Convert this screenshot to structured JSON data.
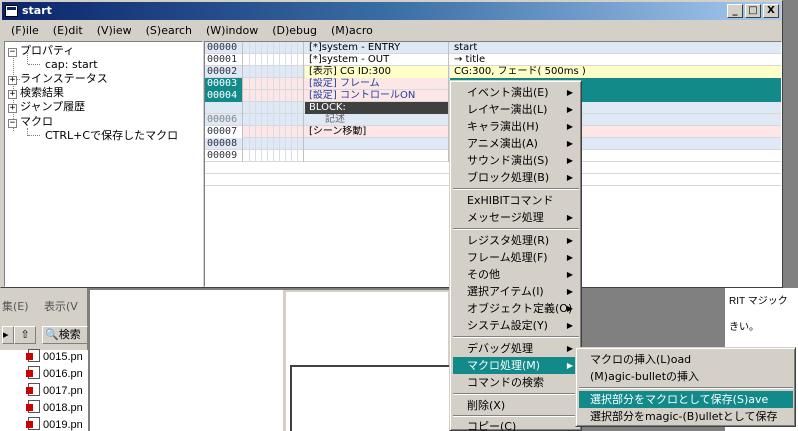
{
  "window": {
    "title": "start"
  },
  "title_controls": {
    "minimize": "_",
    "maximize": "□",
    "close": "X"
  },
  "menubar": [
    "(F)ile",
    "(E)dit",
    "(V)iew",
    "(S)earch",
    "(W)indow",
    "(D)ebug",
    "(M)acro"
  ],
  "tree": {
    "items": [
      {
        "expander": "−",
        "label": "プロパティ"
      },
      {
        "expander": "",
        "label": "cap: start"
      },
      {
        "expander": "+",
        "label": "ラインステータス"
      },
      {
        "expander": "+",
        "label": "検索結果"
      },
      {
        "expander": "+",
        "label": "ジャンプ履歴"
      },
      {
        "expander": "−",
        "label": "マクロ"
      },
      {
        "expander": "",
        "label": "CTRL+Cで保存したマクロ"
      }
    ]
  },
  "grid": {
    "rows": [
      {
        "num": "00000",
        "cmd": "[*]system -  ENTRY",
        "arg": "start"
      },
      {
        "num": "00001",
        "cmd": "[*]system -  OUT",
        "arg": "→ title"
      },
      {
        "num": "00002",
        "cmd": "[表示] CG ID:300",
        "arg": "CG:300, フェード( 500ms )"
      },
      {
        "num": "00003",
        "cmd": "[設定] フレーム",
        "arg": ""
      },
      {
        "num": "00004",
        "cmd": "[設定] コントロールON",
        "arg": ""
      },
      {
        "num": "",
        "cmd": "BLOCK:",
        "arg": ""
      },
      {
        "num": "00006",
        "cmd": "記述",
        "arg": ""
      },
      {
        "num": "00007",
        "cmd": "[シーン移動]",
        "arg": ""
      },
      {
        "num": "00008",
        "cmd": "",
        "arg": ""
      },
      {
        "num": "00009",
        "cmd": "",
        "arg": ""
      }
    ]
  },
  "context_menu": {
    "items": [
      {
        "label": "イベント演出(E)",
        "submenu": true
      },
      {
        "label": "レイヤー演出(L)",
        "submenu": true
      },
      {
        "label": "キャラ演出(H)",
        "submenu": true
      },
      {
        "label": "アニメ演出(A)",
        "submenu": true
      },
      {
        "label": "サウンド演出(S)",
        "submenu": true
      },
      {
        "label": "ブロック処理(B)",
        "submenu": true
      },
      {
        "label": "ExHIBITコマンド",
        "submenu": false
      },
      {
        "label": "メッセージ処理",
        "submenu": true
      },
      {
        "label": "レジスタ処理(R)",
        "submenu": true
      },
      {
        "label": "フレーム処理(F)",
        "submenu": true
      },
      {
        "label": "その他",
        "submenu": true
      },
      {
        "label": "選択アイテム(I)",
        "submenu": true
      },
      {
        "label": "オブジェクト定義(O)",
        "submenu": true
      },
      {
        "label": "システム設定(Y)",
        "submenu": true
      },
      {
        "label": "デバッグ処理",
        "submenu": true
      },
      {
        "label": "マクロ処理(M)",
        "submenu": true
      },
      {
        "label": "コマンドの検索",
        "submenu": false
      },
      {
        "label": "削除(X)",
        "submenu": false
      },
      {
        "label": "コピー(C)",
        "submenu": false
      }
    ]
  },
  "submenu": {
    "items": [
      {
        "label": "マクロの挿入(L)oad"
      },
      {
        "label": "(M)agic-bulletの挿入"
      },
      {
        "label": "選択部分をマクロとして保存(S)ave"
      },
      {
        "label": "選択部分をmagic-(B)ulletとして保存"
      }
    ]
  },
  "background": {
    "left_menu": [
      "集(E)",
      "表示(V"
    ],
    "left_toolbar": [
      "検索"
    ],
    "files": [
      "0015.pn",
      "0016.pn",
      "0017.pn",
      "0018.pn",
      "0019.pn"
    ],
    "right_text": [
      "RIT マジック",
      "きい。"
    ]
  },
  "colors": {
    "accent": "#128a8a",
    "title_start": "#0a246a",
    "title_end": "#a6caf0",
    "row_blue": "#dfe8f5",
    "row_yellow": "#ffffc8",
    "row_pink": "#fde6e6"
  }
}
